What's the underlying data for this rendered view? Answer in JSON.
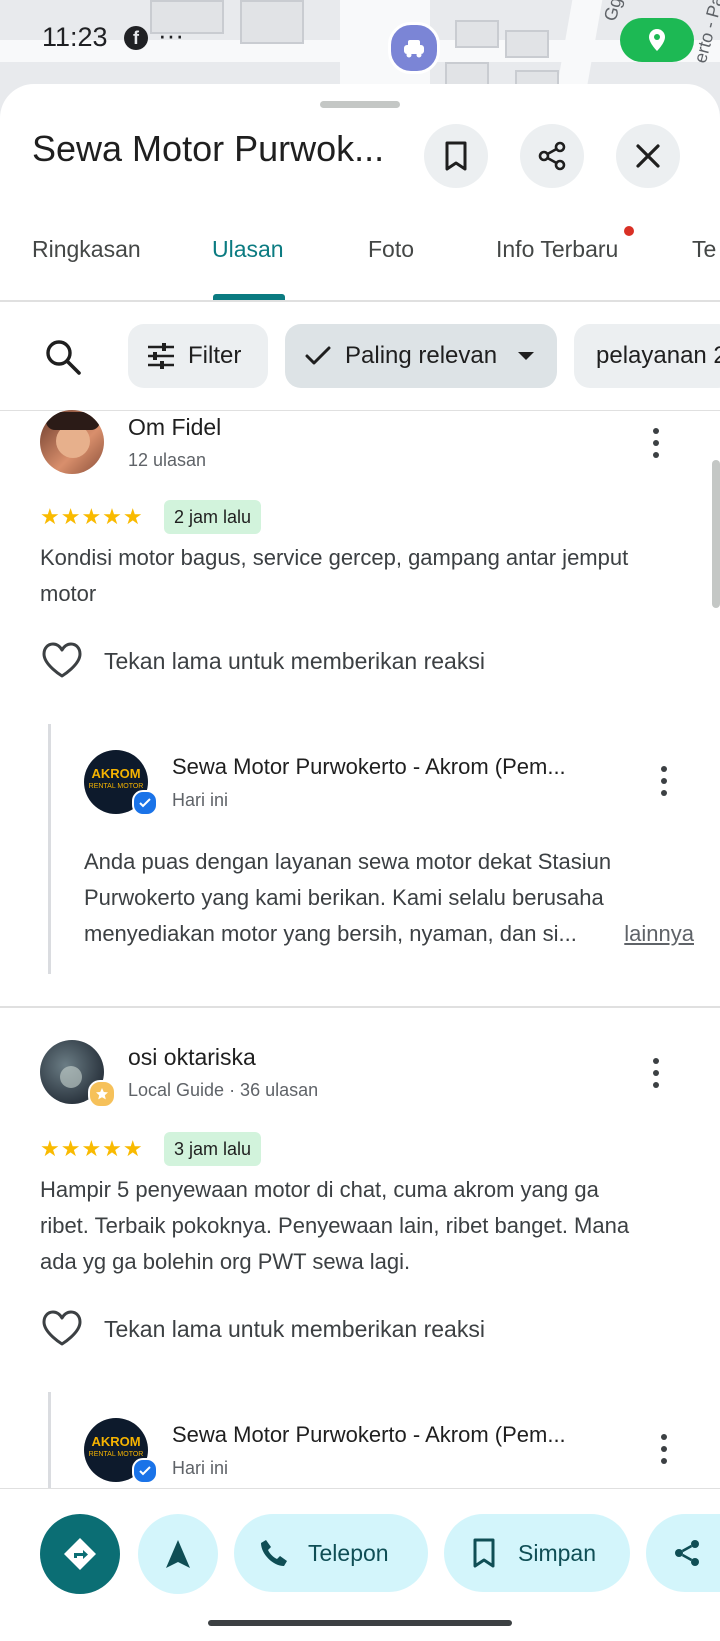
{
  "status_bar": {
    "time": "11:23",
    "more": "···"
  },
  "map": {
    "street_label": "Gg. M",
    "street_label_2": "erto - Pa"
  },
  "header": {
    "title": "Sewa Motor Purwok..."
  },
  "tabs": [
    {
      "label": "Ringkasan"
    },
    {
      "label": "Ulasan"
    },
    {
      "label": "Foto"
    },
    {
      "label": "Info Terbaru"
    },
    {
      "label": "Te"
    }
  ],
  "filters": {
    "filter_label": "Filter",
    "sort_label": "Paling relevan",
    "topic_label": "pelayanan 2"
  },
  "reviews": [
    {
      "name": "Om Fidel",
      "meta": "12 ulasan",
      "stars": "★★★★★",
      "time": "2 jam lalu",
      "text_lines": [
        "Kondisi motor bagus, service gercep, gampang antar jemput",
        "motor"
      ],
      "react_label": "Tekan lama untuk memberikan reaksi",
      "reply": {
        "name": "Sewa Motor Purwokerto - Akrom (Pem...",
        "time": "Hari ini",
        "text_lines": [
          "Anda puas dengan layanan sewa motor dekat Stasiun",
          "Purwokerto yang kami berikan. Kami selalu berusaha",
          "menyediakan motor yang bersih, nyaman, dan si..."
        ],
        "more_label": "lainnya"
      }
    },
    {
      "name": "osi oktariska",
      "meta": "Local Guide · 36 ulasan",
      "stars": "★★★★★",
      "time": "3 jam lalu",
      "text_lines": [
        "Hampir 5 penyewaan motor di chat, cuma akrom yang ga",
        "ribet. Terbaik pokoknya. Penyewaan lain, ribet banget. Mana",
        "ada yg ga bolehin org PWT sewa lagi."
      ],
      "react_label": "Tekan lama untuk memberikan reaksi",
      "reply": {
        "name": "Sewa Motor Purwokerto - Akrom (Pem...",
        "time": "Hari ini"
      }
    }
  ],
  "owner_logo_text": {
    "brand": "AKROM",
    "sub": "RENTAL MOTOR"
  },
  "actions": {
    "call_label": "Telepon",
    "save_label": "Simpan"
  },
  "colors": {
    "accent": "#0b7b81",
    "primary_button": "#0b6e74",
    "action_bg": "#d3f5fb",
    "time_badge": "#d2f3dc",
    "star": "#f9ba00"
  }
}
